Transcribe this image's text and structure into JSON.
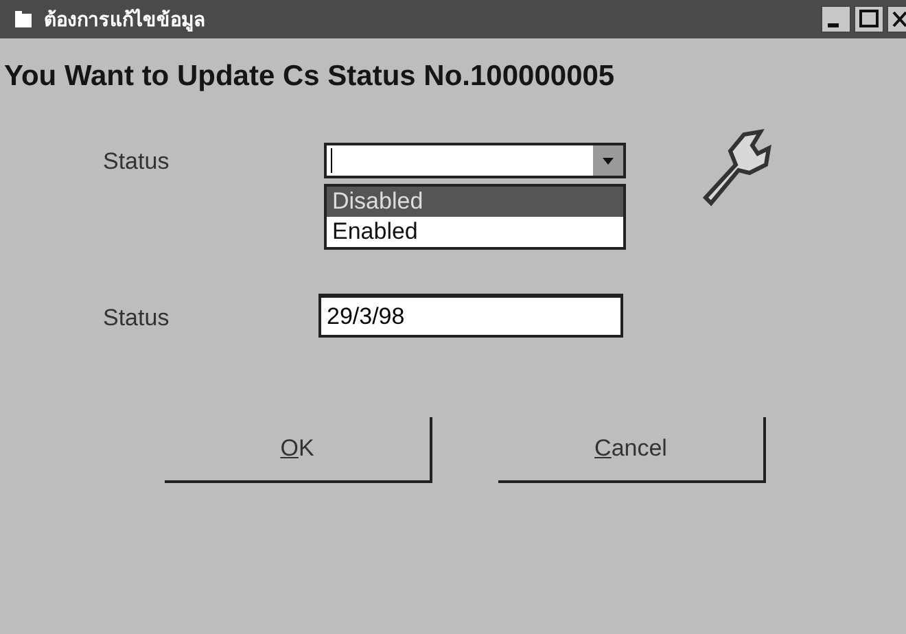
{
  "window": {
    "title": "ต้องการแก้ไขข้อมูล"
  },
  "heading": "You Want to Update Cs Status No.100000005",
  "status_combo": {
    "label": "Status",
    "expanded": true,
    "options": [
      {
        "label": "Disabled",
        "selected": true
      },
      {
        "label": "Enabled",
        "selected": false
      }
    ]
  },
  "date_field": {
    "label": "Status",
    "value": "29/3/98"
  },
  "buttons": [
    "OK",
    "Cancel"
  ]
}
